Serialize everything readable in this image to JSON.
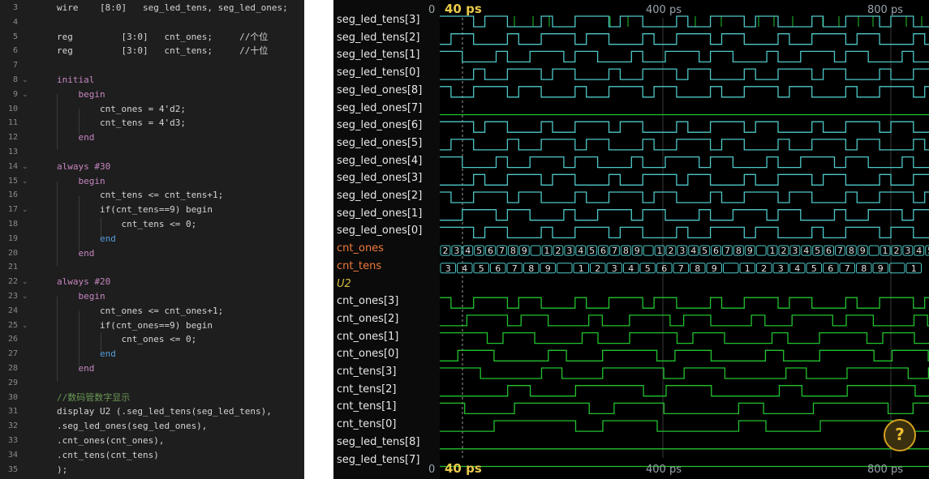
{
  "editor": {
    "lines": [
      {
        "n": "3",
        "fold": "",
        "text": "wire    [8:0]   seg_led_tens, seg_led_ones;",
        "cls": ""
      },
      {
        "n": "4",
        "fold": "",
        "text": "",
        "cls": ""
      },
      {
        "n": "5",
        "fold": "",
        "text": "reg         [3:0]   cnt_ones;     //个位",
        "cls": ""
      },
      {
        "n": "6",
        "fold": "",
        "text": "reg         [3:0]   cnt_tens;     //十位",
        "cls": ""
      },
      {
        "n": "7",
        "fold": "",
        "text": "",
        "cls": ""
      },
      {
        "n": "8",
        "fold": "⌄",
        "text": "initial",
        "cls": "kw"
      },
      {
        "n": "9",
        "fold": "⌄",
        "text": "    begin",
        "cls": "kw"
      },
      {
        "n": "10",
        "fold": "",
        "text": "        cnt_ones = 4'd2;",
        "cls": ""
      },
      {
        "n": "11",
        "fold": "",
        "text": "        cnt_tens = 4'd3;",
        "cls": ""
      },
      {
        "n": "12",
        "fold": "",
        "text": "    end",
        "cls": "kw"
      },
      {
        "n": "13",
        "fold": "",
        "text": "",
        "cls": ""
      },
      {
        "n": "14",
        "fold": "⌄",
        "text": "always #30",
        "cls": "kw"
      },
      {
        "n": "15",
        "fold": "⌄",
        "text": "    begin",
        "cls": "kw"
      },
      {
        "n": "16",
        "fold": "",
        "text": "        cnt_tens <= cnt_tens+1;",
        "cls": ""
      },
      {
        "n": "17",
        "fold": "⌄",
        "text": "        if(cnt_tens==9) begin",
        "cls": ""
      },
      {
        "n": "18",
        "fold": "",
        "text": "            cnt_tens <= 0;",
        "cls": ""
      },
      {
        "n": "19",
        "fold": "",
        "text": "        end",
        "cls": "kw2"
      },
      {
        "n": "20",
        "fold": "",
        "text": "    end",
        "cls": "kw"
      },
      {
        "n": "21",
        "fold": "",
        "text": "",
        "cls": ""
      },
      {
        "n": "22",
        "fold": "⌄",
        "text": "always #20",
        "cls": "kw"
      },
      {
        "n": "23",
        "fold": "⌄",
        "text": "    begin",
        "cls": "kw"
      },
      {
        "n": "24",
        "fold": "",
        "text": "        cnt_ones <= cnt_ones+1;",
        "cls": ""
      },
      {
        "n": "25",
        "fold": "⌄",
        "text": "        if(cnt_ones==9) begin",
        "cls": ""
      },
      {
        "n": "26",
        "fold": "",
        "text": "            cnt_ones <= 0;",
        "cls": ""
      },
      {
        "n": "27",
        "fold": "",
        "text": "        end",
        "cls": "kw2"
      },
      {
        "n": "28",
        "fold": "",
        "text": "    end",
        "cls": "kw"
      },
      {
        "n": "29",
        "fold": "",
        "text": "",
        "cls": ""
      },
      {
        "n": "30",
        "fold": "",
        "text": "//数码管数字显示",
        "cls": "cm"
      },
      {
        "n": "31",
        "fold": "",
        "text": "display U2 (.seg_led_tens(seg_led_tens),",
        "cls": ""
      },
      {
        "n": "32",
        "fold": "",
        "text": ".seg_led_ones(seg_led_ones),",
        "cls": ""
      },
      {
        "n": "33",
        "fold": "",
        "text": ".cnt_ones(cnt_ones),",
        "cls": ""
      },
      {
        "n": "34",
        "fold": "",
        "text": ".cnt_tens(cnt_tens)",
        "cls": ""
      },
      {
        "n": "35",
        "fold": "",
        "text": ");",
        "cls": ""
      }
    ]
  },
  "wave": {
    "time_top": {
      "cursor": "40 ps",
      "t0": "0",
      "t400": "400 ps",
      "t800": "800 ps"
    },
    "time_bottom": {
      "cursor": "40 ps",
      "t0": "0",
      "t400": "400 ps",
      "t800": "800 ps"
    },
    "signals": [
      {
        "name": "seg_led_tens[3]",
        "kind": "bit"
      },
      {
        "name": "seg_led_tens[2]",
        "kind": "bit"
      },
      {
        "name": "seg_led_tens[1]",
        "kind": "bit"
      },
      {
        "name": "seg_led_tens[0]",
        "kind": "bit"
      },
      {
        "name": "seg_led_ones[8]",
        "kind": "bit"
      },
      {
        "name": "seg_led_ones[7]",
        "kind": "bit"
      },
      {
        "name": "seg_led_ones[6]",
        "kind": "bit"
      },
      {
        "name": "seg_led_ones[5]",
        "kind": "bit"
      },
      {
        "name": "seg_led_ones[4]",
        "kind": "bit"
      },
      {
        "name": "seg_led_ones[3]",
        "kind": "bit"
      },
      {
        "name": "seg_led_ones[2]",
        "kind": "bit"
      },
      {
        "name": "seg_led_ones[1]",
        "kind": "bit"
      },
      {
        "name": "seg_led_ones[0]",
        "kind": "bit"
      },
      {
        "name": "cnt_ones",
        "kind": "bus"
      },
      {
        "name": "cnt_tens",
        "kind": "bus"
      },
      {
        "name": "U2",
        "kind": "scope"
      },
      {
        "name": "cnt_ones[3]",
        "kind": "bit"
      },
      {
        "name": "cnt_ones[2]",
        "kind": "bit"
      },
      {
        "name": "cnt_ones[1]",
        "kind": "bit"
      },
      {
        "name": "cnt_ones[0]",
        "kind": "bit"
      },
      {
        "name": "cnt_tens[3]",
        "kind": "bit"
      },
      {
        "name": "cnt_tens[2]",
        "kind": "bit"
      },
      {
        "name": "cnt_tens[1]",
        "kind": "bit"
      },
      {
        "name": "cnt_tens[0]",
        "kind": "bit"
      },
      {
        "name": "seg_led_tens[8]",
        "kind": "bit"
      },
      {
        "name": "seg_led_tens[7]",
        "kind": "bit"
      }
    ],
    "cnt_ones_values": [
      "2",
      "3",
      "4",
      "5",
      "6",
      "7",
      "8",
      "9",
      "",
      "1",
      "2",
      "3",
      "4",
      "5",
      "6",
      "7",
      "8",
      "9",
      "",
      "1",
      "2",
      "3",
      "4",
      "5",
      "6",
      "7",
      "8",
      "9",
      "",
      "1",
      "2",
      "3",
      "4",
      "5",
      "6",
      "7",
      "8",
      "9",
      "",
      "1",
      "2",
      "3",
      "4",
      "5"
    ],
    "cnt_tens_values": [
      "3",
      "4",
      "5",
      "6",
      "7",
      "8",
      "9",
      "",
      "1",
      "2",
      "3",
      "4",
      "5",
      "6",
      "7",
      "8",
      "9",
      "",
      "1",
      "2",
      "3",
      "4",
      "5",
      "6",
      "7",
      "8",
      "9",
      "",
      "1"
    ],
    "help_label": "?"
  },
  "colors": {
    "wave_green": "#22c32e",
    "wave_cyan": "#4fc8c8",
    "bus_orange": "#f07a3a",
    "cursor_yellow": "#e8c84a"
  }
}
